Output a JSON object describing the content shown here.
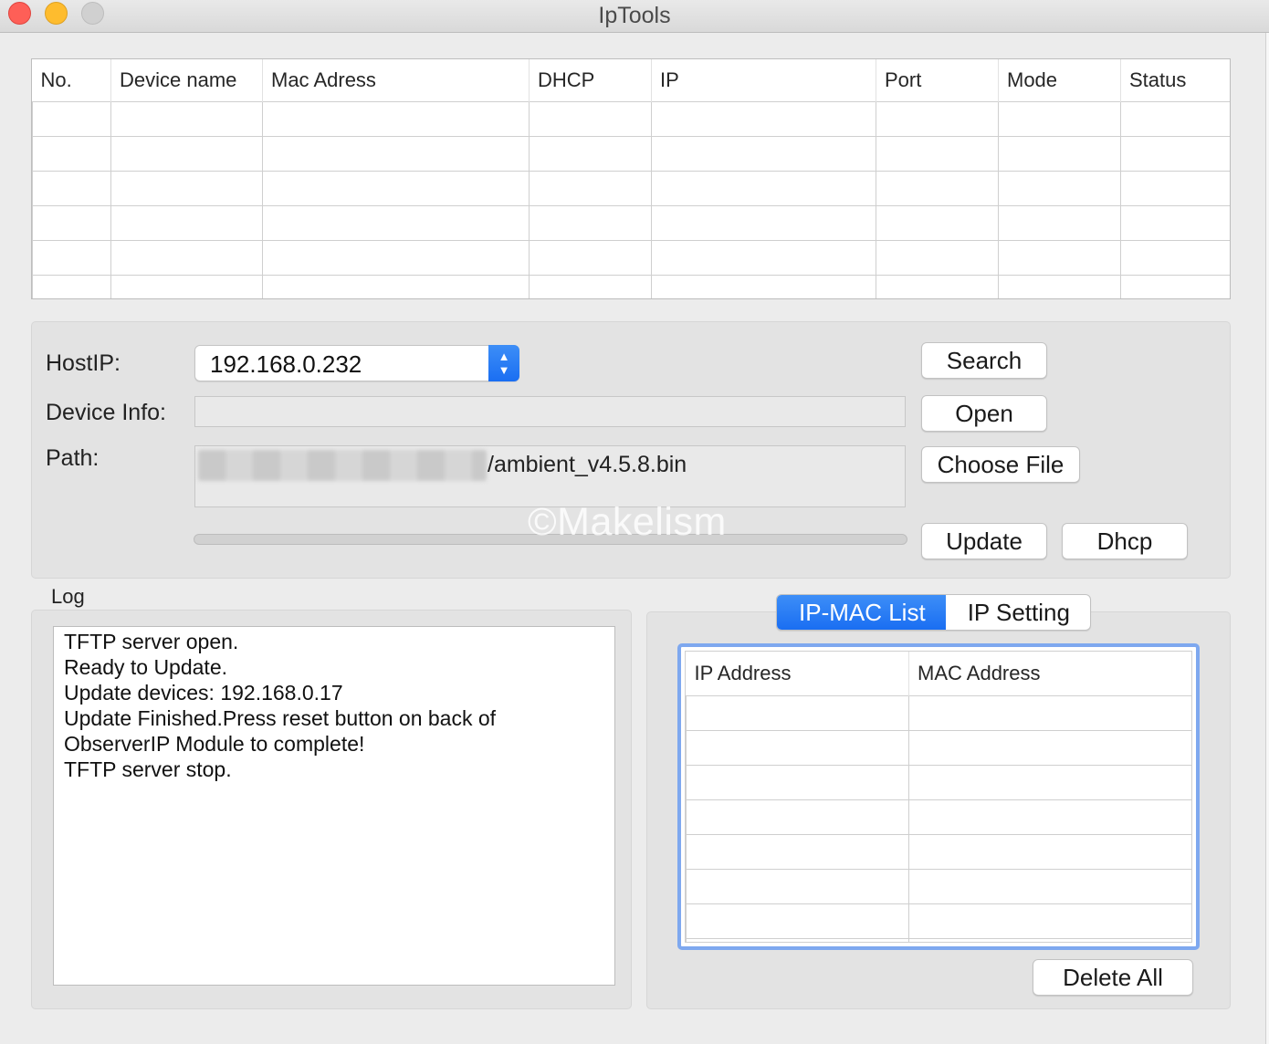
{
  "window": {
    "title": "IpTools",
    "controls": [
      "close",
      "minimize",
      "maximize"
    ]
  },
  "device_table": {
    "columns": [
      "No.",
      "Device name",
      "Mac Adress",
      "DHCP",
      "IP",
      "Port",
      "Mode",
      "Status"
    ],
    "rows": []
  },
  "controls": {
    "host_ip_label": "HostIP:",
    "host_ip_value": "192.168.0.232",
    "device_info_label": "Device Info:",
    "device_info_value": "",
    "path_label": "Path:",
    "path_value": "/ambient_v4.5.8.bin",
    "progress": 0,
    "buttons": {
      "search": "Search",
      "open": "Open",
      "choose_file": "Choose File",
      "update": "Update",
      "dhcp": "Dhcp"
    }
  },
  "watermark": "©Makelism",
  "log": {
    "title": "Log",
    "lines": [
      "TFTP server open.",
      "Ready to Update.",
      "Update devices: 192.168.0.17",
      "Update Finished.Press reset button on back of",
      "ObserverIP Module to complete!",
      "TFTP server stop."
    ]
  },
  "mac_panel": {
    "tabs": [
      "IP-MAC List",
      "IP Setting"
    ],
    "active_tab": "IP-MAC List",
    "columns": [
      "IP Address",
      "MAC Address"
    ],
    "rows": [],
    "delete_all": "Delete All"
  },
  "colors": {
    "accent": "#1a6ef2",
    "focus_ring": "#7ea8ef",
    "close": "#fe5f57",
    "minimize": "#febc2e",
    "window_bg": "#ececec"
  }
}
